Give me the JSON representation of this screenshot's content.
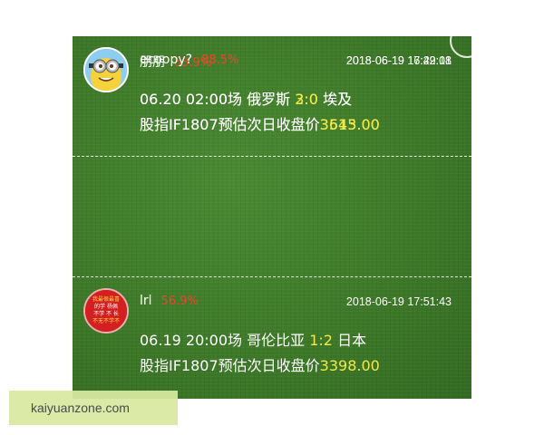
{
  "entries": [
    {
      "user": "朋朋",
      "score": "83.9%",
      "time": "2018-06-19 16:29:01",
      "match_time": "06.20 02:00场",
      "team_a": "俄罗斯",
      "result": "2:0",
      "team_b": "埃及",
      "prediction_label": "股指IF1807预估次日收盘价",
      "prediction_value": "3615.00",
      "avatar": "photo-avatar"
    },
    {
      "user": "lrl",
      "score": "56.9%",
      "time": "2018-06-19 17:51:43",
      "match_time": "06.19 20:00场",
      "team_a": "哥伦比亚",
      "result": "1:2",
      "team_b": "日本",
      "prediction_label": "股指IF1807预估次日收盘价",
      "prediction_value": "3398.00",
      "avatar": "red-text-avatar",
      "avatar_text": [
        "我最很最喜",
        "的学   杨佩",
        "不学 不 长",
        "不无不学不"
      ]
    },
    {
      "user": "ecoopy?",
      "score": "88.5%",
      "time": "2018-06-19 17:42:18",
      "match_time": "06.20 02:00场",
      "team_a": "俄罗斯",
      "result": "3:0",
      "team_b": "埃及",
      "prediction_label": "股指IF1807预估次日收盘价",
      "prediction_value": "3543.00",
      "avatar": "minion-avatar"
    }
  ],
  "watermark": "kaiyuanzone.com",
  "colors": {
    "background_green": "#3f7a2a",
    "score_red": "#e44a2c",
    "highlight_yellow": "#f3e84a",
    "watermark_bg": "#d8e9a0"
  }
}
